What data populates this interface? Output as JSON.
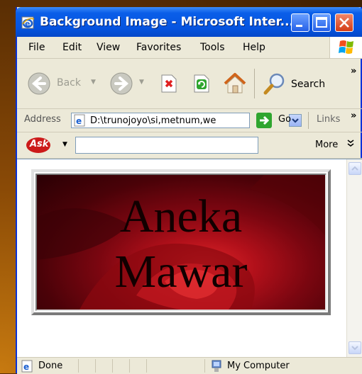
{
  "window": {
    "title": "Background Image - Microsoft Inter..."
  },
  "menu": {
    "items": [
      {
        "label": "File"
      },
      {
        "label": "Edit"
      },
      {
        "label": "View"
      },
      {
        "label": "Favorites"
      },
      {
        "label": "Tools"
      },
      {
        "label": "Help"
      }
    ]
  },
  "toolbar": {
    "back_label": "Back",
    "search_label": "Search"
  },
  "address": {
    "label": "Address",
    "value": "D:\\trunojoyo\\si,metnum,we",
    "go_label": "Go",
    "links_label": "Links"
  },
  "askbar": {
    "logo_text": "Ask",
    "search_value": "",
    "more_label": "More"
  },
  "page": {
    "banner_line1": "Aneka",
    "banner_line2": "Mawar"
  },
  "status": {
    "text": "Done",
    "zone": "My Computer"
  },
  "colors": {
    "titlebar": "#0554e0",
    "window_bg": "#ece9d8",
    "banner_red": "#b1101a"
  }
}
